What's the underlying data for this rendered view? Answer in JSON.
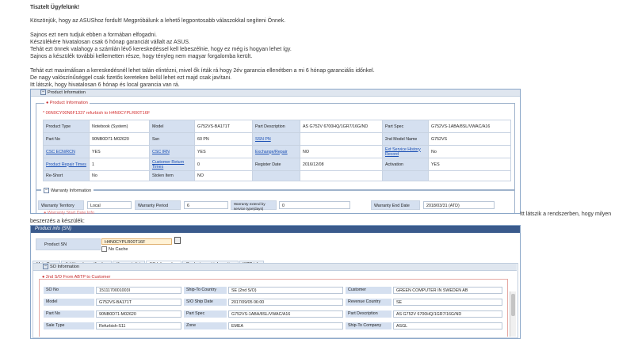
{
  "email": {
    "greeting": "Tisztelt Ügyfelünk!",
    "line1": "Köszönjük, hogy az ASUShoz fordult! Megpróbálunk a lehető legpontosabb válaszokkal segíteni Önnek.",
    "line2": "Sajnos ezt nem tudjuk ebben a formában elfogadni.",
    "line3": "Készülékére hivatalosan csak 6 hónap garanciát vállalt az ASUS.",
    "line4": "Tehát ezt önnek valahogy a számlán lévő kereskedéssel kell lebeszélnie, hogy ez még is hogyan lehet így.",
    "line5": "Sajnos a készülék további kellemetten része, hogy tényleg nem magyar forgalomba került.",
    "line6": "Tehát ezt maximálisan a kereskedésnél lehet talán elintézni, mivel ők írták rá hogy 2év garancia ellenétben a mi 6 hónap garanciális időnkel.",
    "line7": "De nagy valószínűséggel csak fizetős kereteken belül lehet ezt majd csak javítani.",
    "line8": "Itt látszik, hogy hivatalosan 6 hónap és local garancia van rá."
  },
  "side_text": {
    "line1": "Itt látszik a rendszerben, hogy milyen",
    "line2": "beszerzés a készülék:"
  },
  "product_panel": {
    "bar_label": "Product Information",
    "section_title": "Product Information",
    "refurb_note": "* 06N0CY00N6F1337 refurbish to H4N0CYPLR00T16F",
    "rows": [
      [
        "Product Type",
        "Notebook (System)",
        "Model",
        "G752VS-BA171T",
        "Part Description",
        "AS G752V 6700HQ/1GR7/16G/ND",
        "Part Spec",
        "G752VS-1ABA/8SL/VWAC/A16"
      ],
      [
        "Part No",
        "90NB0D71-M02620",
        "Ssn",
        "60 PN",
        "SSN PN",
        "",
        "2nd Model Name",
        "G752VS"
      ],
      [
        "CSC ECN/RCN",
        "YES",
        "CSC IRN",
        "YES",
        "Exchange/Repair",
        "NO",
        "Ext Service History Record",
        "No"
      ],
      [
        "Product Repair Times",
        "1",
        "Customer Return Times",
        "0",
        "Register Date",
        "2016/12/08",
        "Activation",
        "YES"
      ],
      [
        "Re-Short",
        "No",
        "Stolen Item",
        "NO",
        "",
        "",
        "",
        ""
      ]
    ],
    "warranty_title": "Warranty Information",
    "warranty": {
      "territory_label": "Warranty Territory",
      "territory_value": "Local",
      "period_label": "Warranty Period",
      "period_value": "6",
      "extend_label": "Warranty extend by service type(days)",
      "extend_value": "0",
      "end_label": "Warranty End Date",
      "end_value": "2018/03/31 (ATD)"
    },
    "start_date_title": "Warranty Start Date Info"
  },
  "info_panel": {
    "header": "Product info (SN)",
    "sn_label": "Product SN",
    "sn_value": "H4N0CYPLR00T16F",
    "no_cache": "No Cache",
    "tabs": [
      "Main Page",
      "Additional specification",
      "Key parts list",
      "SO Information",
      "Product event information",
      "WTP info"
    ],
    "active_tab": "SO Information",
    "so_title": "SO Information",
    "so_sub_title": "2nd S/O From ABTP to Customer",
    "fields": {
      "so_no_label": "SO No",
      "so_no": "1511170001003I",
      "model_label": "Model",
      "model": "G752VS-BA171T",
      "part_no_label": "Part No",
      "part_no": "90NB0D71-M02620",
      "sale_type_label": "Sale Type",
      "sale_type": "Refurbish-S11",
      "ship_to_country_label": "Ship-To Country",
      "ship_to_country": "SE (2nd S/O)",
      "ship_date_label": "S/O Ship Date",
      "ship_date": "2017/09/05 06:00",
      "part_spec_label": "Part Spec",
      "part_spec": "G752VS-1ABA/8SL/VWAC/A16",
      "zone_label": "Zone",
      "zone": "EMEA",
      "customer_label": "Customer",
      "customer": "GREEN COMPUTER IN SWEDEN AB",
      "revenue_country_label": "Revenue Country",
      "revenue_country": "SE",
      "part_desc_label": "Part Description",
      "part_desc": "AS G752V 6700HQ/1GR7/16G/ND",
      "ship_to_company_label": "Ship-To Company",
      "ship_to_company": "ASGL"
    }
  }
}
